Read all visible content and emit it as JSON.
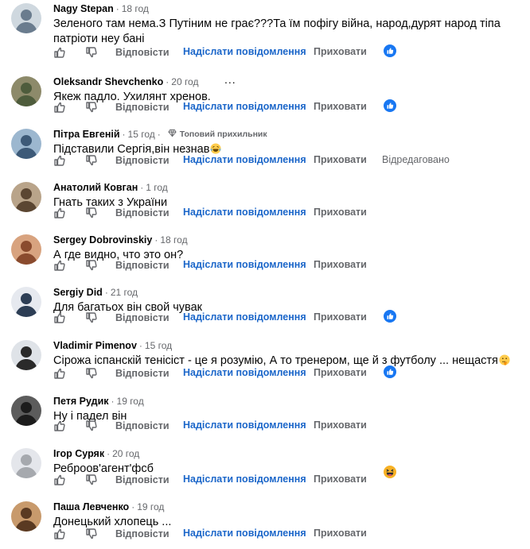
{
  "actions": {
    "reply_label": "Відповісти",
    "message_label": "Надіслати повідомлення",
    "hide_label": "Приховати",
    "separator": "·"
  },
  "comments": [
    {
      "author": "Nagy Stepan",
      "time": "18 год",
      "text": "Зеленого там нема.З Путіним не грає???Та їм пофігу війна, народ,дурят народ тіпа патріоти неу  бані",
      "reaction": "like"
    },
    {
      "author": "Oleksandr Shevchenko",
      "time": "20 год",
      "text": "Якеж падло. Ухилянт хренов.",
      "more_menu": "...",
      "reaction": "like"
    },
    {
      "author": "Пітра Евгеній",
      "time": "15 год",
      "badge": "Топовий прихильник",
      "badge_icon": "diamond-icon",
      "text": "Підставили Сергія,він незнав",
      "text_emoji": "laughing-tears-emoji",
      "edited": "Відредаговано"
    },
    {
      "author": "Анатолий Ковган",
      "time": "1 год",
      "text": "Гнать таких з України"
    },
    {
      "author": "Sergey Dobrovinskiy",
      "time": "18 год",
      "text": "А где видно, что это он?"
    },
    {
      "author": "Sergiy Did",
      "time": "21 год",
      "text": "Для багатьох він свой чувак",
      "reaction": "like"
    },
    {
      "author": "Vladimir Pimenov",
      "time": "15 год",
      "text": "Сірожа іспанскій тенісіст - це я розумію, А то тренером, ще й з футболу ... нещастя",
      "text_emoji": "thinking-face-emoji",
      "reaction": "like"
    },
    {
      "author": "Петя Рудик",
      "time": "19 год",
      "text": "Ну і падел він"
    },
    {
      "author": "Ігор Суряк",
      "time": "20 год",
      "text": "Реброов'агент'фсб",
      "reaction": "haha"
    },
    {
      "author": "Паша Левченко",
      "time": "19 год",
      "text": "Донецький хлопець ..."
    }
  ],
  "colors": {
    "link_blue": "#1b66c9",
    "like_blue": "#1877f2",
    "muted_gray": "#65676b",
    "text": "#050505",
    "haha_yellow": "#f7b125"
  }
}
